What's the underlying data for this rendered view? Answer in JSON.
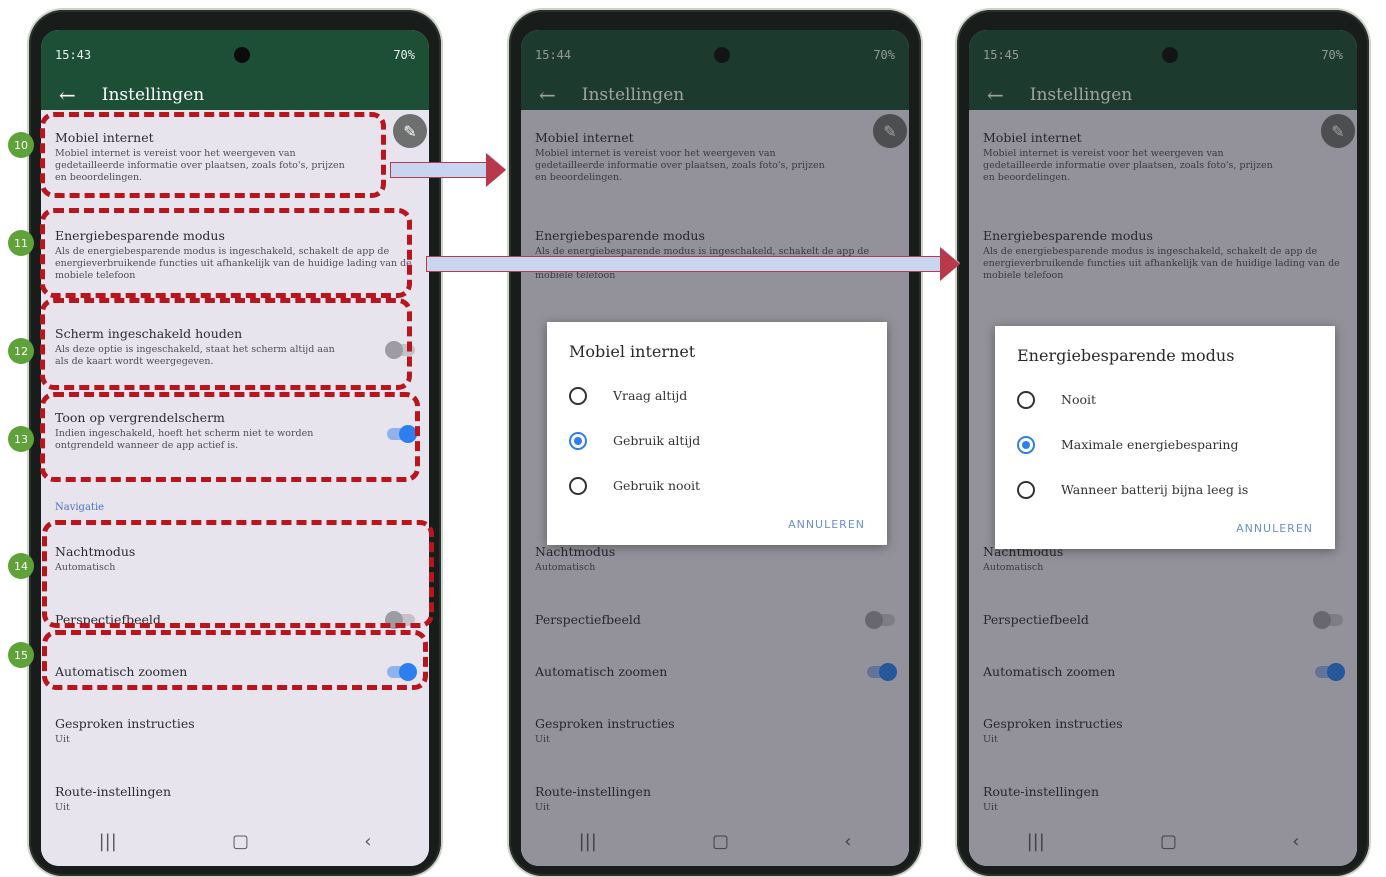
{
  "badges": [
    "10",
    "11",
    "12",
    "13",
    "14",
    "15"
  ],
  "screens": [
    {
      "time": "15:43",
      "status_right": "70%"
    },
    {
      "time": "15:44",
      "status_right": "70%"
    },
    {
      "time": "15:45",
      "status_right": "70%"
    }
  ],
  "appbar": {
    "back": "←",
    "title": "Instellingen",
    "edit": "✎"
  },
  "settings": {
    "mobile_internet": {
      "title": "Mobiel internet",
      "desc": "Mobiel internet is vereist voor het weergeven van gedetailleerde informatie over plaatsen, zoals foto's, prijzen en beoordelingen."
    },
    "energy_saving": {
      "title": "Energiebesparende modus",
      "desc": "Als de energiebesparende modus is ingeschakeld, schakelt de app de energieverbruikende functies uit afhankelijk van de huidige lading van de mobiele telefoon"
    },
    "screen_on": {
      "title": "Scherm ingeschakeld houden",
      "desc": "Als deze optie is ingeschakeld, staat het scherm altijd aan als de kaart wordt weergegeven.",
      "enabled": false
    },
    "lockscreen": {
      "title": "Toon op vergrendelscherm",
      "desc": "Indien ingeschakeld, hoeft het scherm niet te worden ontgrendeld wanneer de app actief is.",
      "enabled": true
    },
    "nav_section": "Navigatie",
    "night_mode": {
      "title": "Nachtmodus",
      "value": "Automatisch"
    },
    "perspective": {
      "title": "Perspectiefbeeld",
      "enabled": false
    },
    "auto_zoom": {
      "title": "Automatisch zoomen",
      "enabled": true
    },
    "voice": {
      "title": "Gesproken instructies",
      "value": "Uit"
    },
    "route": {
      "title": "Route-instellingen",
      "value": "Uit"
    }
  },
  "navbar": {
    "recent": "|||",
    "home": "▢",
    "back": "‹"
  },
  "dialog_mobile": {
    "title": "Mobiel internet",
    "options": [
      "Vraag altijd",
      "Gebruik altijd",
      "Gebruik nooit"
    ],
    "selected_index": 1,
    "cancel": "ANNULEREN"
  },
  "dialog_energy": {
    "title": "Energiebesparende modus",
    "options": [
      "Nooit",
      "Maximale energiebesparing",
      "Wanneer batterij bijna leeg is"
    ],
    "selected_index": 1,
    "cancel": "ANNULEREN"
  },
  "colors": {
    "appbar": "#1d4f36",
    "accent": "#2d7ff0",
    "highlight": "#b8151d",
    "badge": "#5fa23a"
  }
}
